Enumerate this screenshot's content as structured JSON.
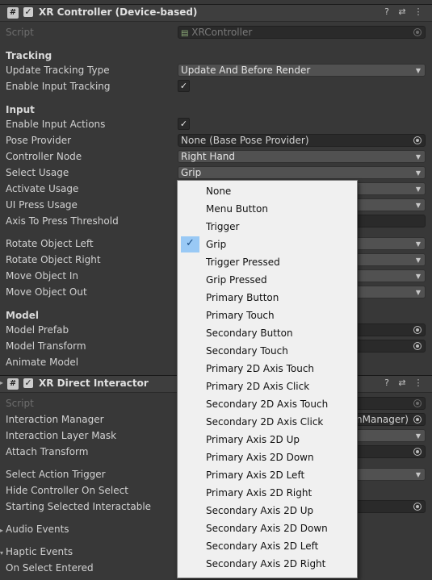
{
  "controller": {
    "title": "XR Controller (Device-based)",
    "icon": "#",
    "enabled_mark": "✓",
    "script_label": "Script",
    "script_value": "XRController",
    "tracking_section": "Tracking",
    "update_tracking_type_label": "Update Tracking Type",
    "update_tracking_type_value": "Update And Before Render",
    "enable_input_tracking_label": "Enable Input Tracking",
    "input_section": "Input",
    "enable_input_actions_label": "Enable Input Actions",
    "pose_provider_label": "Pose Provider",
    "pose_provider_value": "None (Base Pose Provider)",
    "controller_node_label": "Controller Node",
    "controller_node_value": "Right Hand",
    "select_usage_label": "Select Usage",
    "select_usage_value": "Grip",
    "activate_usage_label": "Activate Usage",
    "ui_press_usage_label": "UI Press Usage",
    "axis_to_press_threshold_label": "Axis To Press Threshold",
    "rotate_object_left_label": "Rotate Object Left",
    "rotate_object_right_label": "Rotate Object Right",
    "move_object_in_label": "Move Object In",
    "move_object_out_label": "Move Object Out",
    "model_section": "Model",
    "model_prefab_label": "Model Prefab",
    "model_transform_label": "Model Transform",
    "animate_model_label": "Animate Model"
  },
  "direct_interactor": {
    "title": "XR Direct Interactor",
    "icon": "#",
    "enabled_mark": "✓",
    "script_label": "Script",
    "interaction_manager_label": "Interaction Manager",
    "interaction_manager_value_tail": "nManager)",
    "interaction_layer_mask_label": "Interaction Layer Mask",
    "attach_transform_label": "Attach Transform",
    "select_action_trigger_label": "Select Action Trigger",
    "hide_controller_label": "Hide Controller On Select",
    "starting_selected_label": "Starting Selected Interactable",
    "audio_events_label": "Audio Events",
    "haptic_events_label": "Haptic Events",
    "on_select_entered_label": "On Select Entered"
  },
  "header_buttons": {
    "help": "?",
    "settings": "⇄",
    "more": "⋮"
  },
  "dropdown_menu": {
    "selected_index": 3,
    "check_mark": "✓",
    "items": [
      "None",
      "Menu Button",
      "Trigger",
      "Grip",
      "Trigger Pressed",
      "Grip Pressed",
      "Primary Button",
      "Primary Touch",
      "Secondary Button",
      "Secondary Touch",
      "Primary 2D Axis Touch",
      "Primary 2D Axis Click",
      "Secondary 2D Axis Touch",
      "Secondary 2D Axis Click",
      "Primary Axis 2D Up",
      "Primary Axis 2D Down",
      "Primary Axis 2D Left",
      "Primary Axis 2D Right",
      "Secondary Axis 2D Up",
      "Secondary Axis 2D Down",
      "Secondary Axis 2D Left",
      "Secondary Axis 2D Right"
    ]
  },
  "colors": {
    "panel_bg": "#383838",
    "header_bg": "#3e3e3e",
    "menu_bg": "#f0f0f0",
    "selected_check_bg": "#99c9f5"
  }
}
